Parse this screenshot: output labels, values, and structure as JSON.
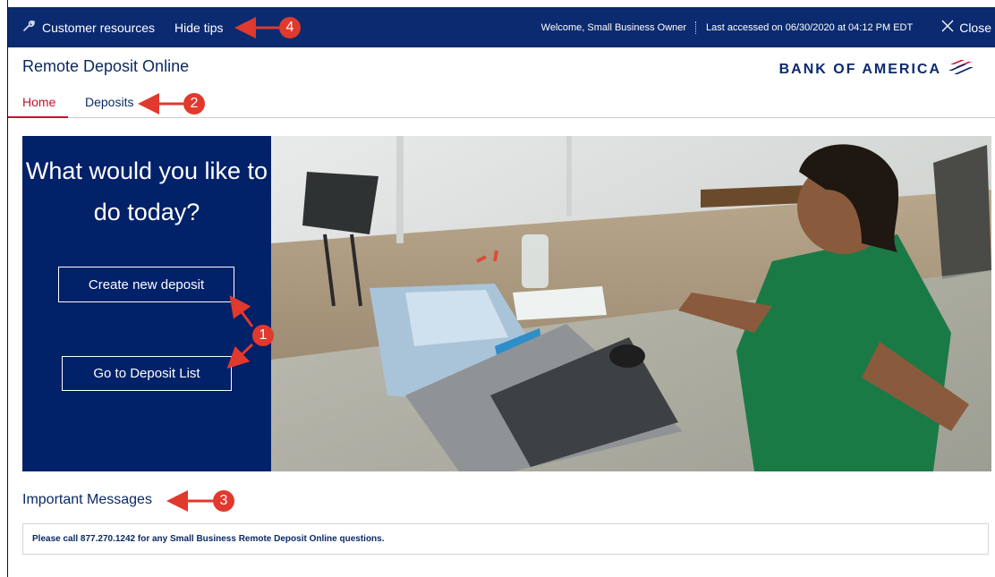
{
  "topbar": {
    "customer_resources": "Customer resources",
    "hide_tips": "Hide tips",
    "welcome": "Welcome, Small Business Owner",
    "last_accessed": "Last accessed on 06/30/2020 at 04:12 PM EDT",
    "close": "Close"
  },
  "header": {
    "app_title": "Remote Deposit Online",
    "logo_text": "BANK OF AMERICA"
  },
  "tabs": [
    {
      "label": "Home",
      "active": true
    },
    {
      "label": "Deposits",
      "active": false
    }
  ],
  "hero": {
    "question": "What would you like to do today?",
    "create_button": "Create new deposit",
    "list_button": "Go to Deposit List"
  },
  "messages": {
    "heading": "Important Messages",
    "text": "Please call 877.270.1242 for any Small Business Remote Deposit Online questions."
  },
  "callouts": [
    "1",
    "2",
    "3",
    "4"
  ],
  "colors": {
    "navy": "#012169",
    "topbar": "#0b2a6f",
    "red": "#c8102e",
    "callout": "#e0392d"
  },
  "icons": {
    "resources": "wrench-icon",
    "close": "close-icon",
    "logo": "flag-stripes-icon"
  }
}
